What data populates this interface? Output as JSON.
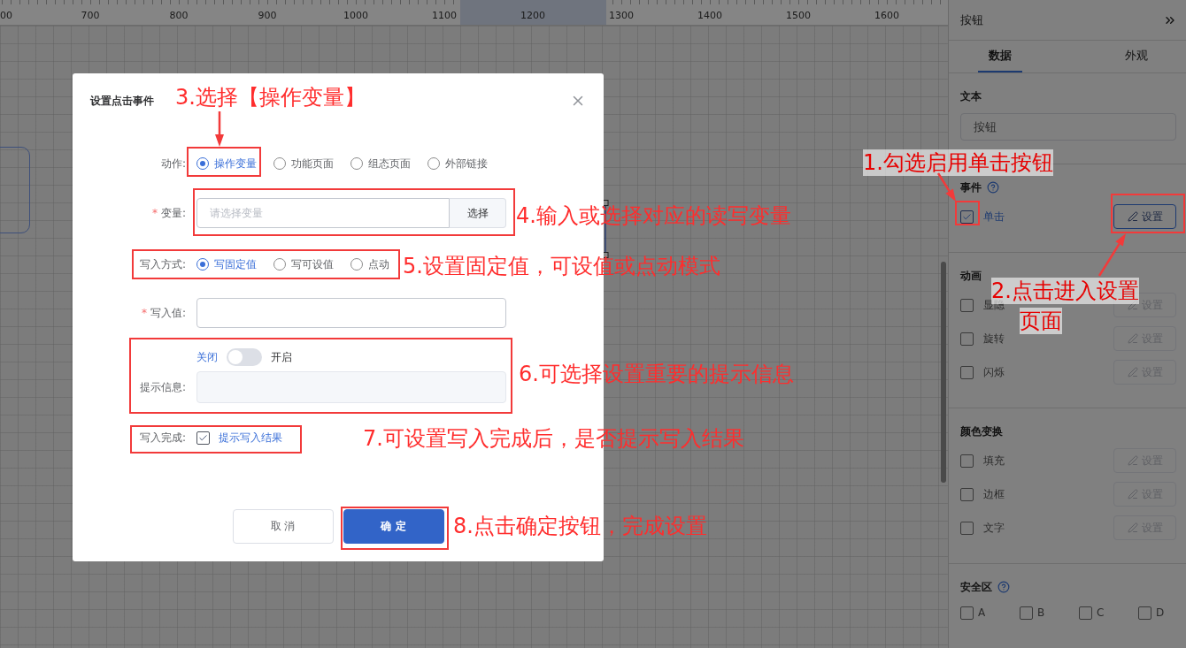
{
  "ruler": {
    "labels": [
      "00",
      "700",
      "800",
      "900",
      "1000",
      "1100",
      "1200",
      "1300",
      "1400",
      "1500",
      "1600"
    ]
  },
  "dialog": {
    "title": "设置点击事件",
    "action": {
      "label": "动作:",
      "options": [
        {
          "label": "操作变量",
          "selected": true
        },
        {
          "label": "功能页面",
          "selected": false
        },
        {
          "label": "组态页面",
          "selected": false
        },
        {
          "label": "外部链接",
          "selected": false
        }
      ]
    },
    "variable": {
      "required_mark": "*",
      "label": "变量:",
      "placeholder": "请选择变量",
      "button": "选择"
    },
    "write_mode": {
      "label": "写入方式:",
      "options": [
        {
          "label": "写固定值",
          "selected": true
        },
        {
          "label": "写可设值",
          "selected": false
        },
        {
          "label": "点动",
          "selected": false
        }
      ]
    },
    "write_value": {
      "required_mark": "*",
      "label": "写入值:"
    },
    "prompt": {
      "label": "提示信息:",
      "off_label": "关闭",
      "on_label": "开启",
      "on": false
    },
    "write_complete": {
      "label": "写入完成:",
      "checkbox_label": "提示写入结果",
      "checked": true
    },
    "buttons": [
      {
        "label": "取 消",
        "kind": "default"
      },
      {
        "label": "确 定",
        "kind": "primary"
      }
    ]
  },
  "panel": {
    "title": "按钮",
    "tabs": [
      {
        "label": "数据",
        "selected": true
      },
      {
        "label": "外观",
        "selected": false
      }
    ],
    "text_section": {
      "title": "文本",
      "value": "按钮"
    },
    "sections": [
      {
        "title": "事件",
        "help": true,
        "rows": [
          {
            "label": "单击",
            "checked": true,
            "button": "设置"
          }
        ]
      },
      {
        "title": "动画",
        "help": false,
        "rows": [
          {
            "label": "显隐",
            "checked": false,
            "button": "设置"
          },
          {
            "label": "旋转",
            "checked": false,
            "button": "设置"
          },
          {
            "label": "闪烁",
            "checked": false,
            "button": "设置"
          }
        ]
      },
      {
        "title": "颜色变换",
        "help": false,
        "rows": [
          {
            "label": "填充",
            "checked": false,
            "button": "设置"
          },
          {
            "label": "边框",
            "checked": false,
            "button": "设置"
          },
          {
            "label": "文字",
            "checked": false,
            "button": "设置"
          }
        ]
      }
    ],
    "safe_zone": {
      "title": "安全区",
      "help": true,
      "options": [
        {
          "label": "A",
          "checked": false
        },
        {
          "label": "B",
          "checked": false
        },
        {
          "label": "C",
          "checked": false
        },
        {
          "label": "D",
          "checked": false
        }
      ]
    }
  },
  "annotations": [
    "1.勾选启用单击按钮",
    "2.点击进入设置",
    "页面",
    "3.选择【操作变量】",
    "4.输入或选择对应的读写变量",
    "5.设置固定值，可设值或点动模式",
    "6.可选择设置重要的提示信息",
    "7.可设置写入完成后，是否提示写入结果",
    "8.点击确定按钮，完成设置"
  ]
}
